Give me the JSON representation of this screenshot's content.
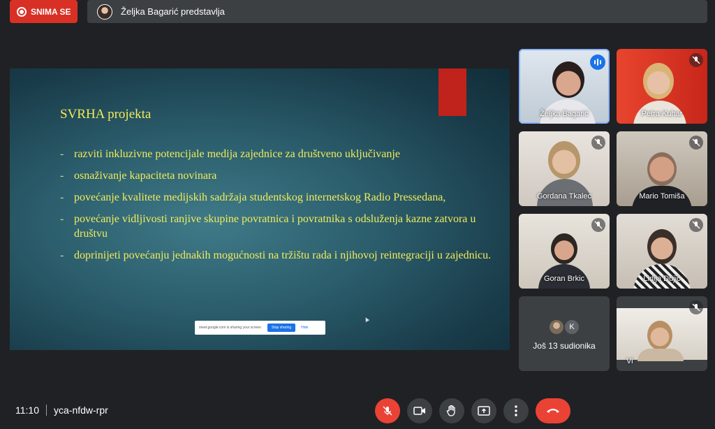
{
  "topbar": {
    "recording_label": "SNIMA SE",
    "presenting_text": "Željka Bagarić predstavlja"
  },
  "slide": {
    "title": "SVRHA projekta",
    "bullets": [
      "razviti inkluzivne potencijale medija zajednice za društveno uključivanje",
      "osnaživanje kapaciteta novinara",
      "povećanje kvalitete medijskih sadržaja studentskog internetskog Radio Pressedana,",
      "povećanje vidljivosti ranjive skupine povratnica i povratnika s odsluženja kazne zatvora u društvu",
      "doprinijeti povećanju jednakih mogućnosti na tržištu rada i njihovoj reintegraciji u zajednicu."
    ],
    "bullet_marker": "-",
    "share_notice": {
      "text": "meet.google.com is sharing your screen.",
      "stop_label": "Stop sharing",
      "hide_label": "Hide"
    }
  },
  "participants": [
    {
      "name": "Željka Bagarić",
      "state": "speaking"
    },
    {
      "name": "Petra Kuhar",
      "state": "muted"
    },
    {
      "name": "Gordana Tkalec",
      "state": "muted"
    },
    {
      "name": "Mario Tomiša",
      "state": "muted"
    },
    {
      "name": "Goran Brkic",
      "state": "muted"
    },
    {
      "name": "Lidija Dujić",
      "state": "muted"
    },
    {
      "name": "Vi",
      "state": "muted"
    }
  ],
  "more_participants": {
    "avatar_letter": "K",
    "label": "Još 13 sudionika"
  },
  "bottombar": {
    "time": "11:10",
    "meeting_code": "yca-nfdw-rpr"
  },
  "colors": {
    "background": "#202124",
    "recording": "#d93025",
    "slide_text": "#f2ec5a",
    "end_call": "#ea4335",
    "speaking": "#1a73e8"
  },
  "icons": [
    "record-icon",
    "mic-off-icon",
    "camera-icon",
    "raise-hand-icon",
    "present-icon",
    "more-options-icon",
    "end-call-icon"
  ]
}
